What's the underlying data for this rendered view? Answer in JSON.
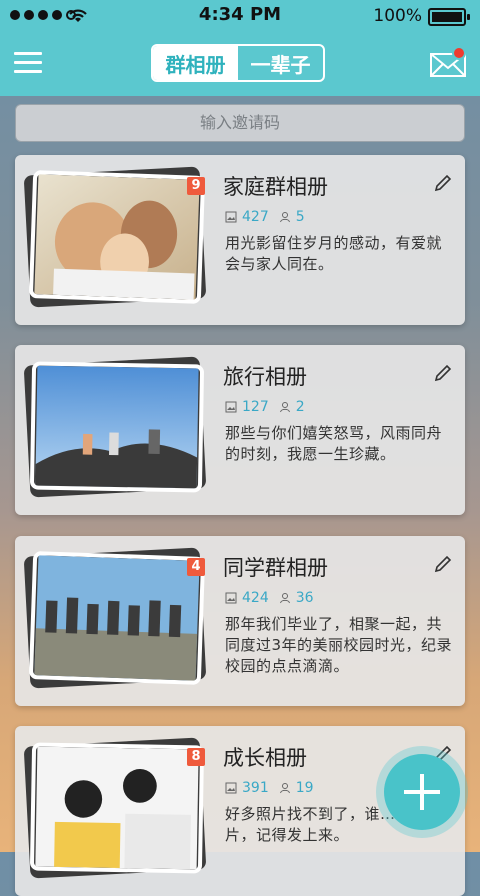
{
  "status_bar": {
    "time": "4:34 PM",
    "battery": "100%"
  },
  "nav": {
    "segments": [
      "群相册",
      "一辈子"
    ],
    "active_index": 0
  },
  "invite": {
    "placeholder": "输入邀请码"
  },
  "albums": [
    {
      "title": "家庭群相册",
      "badge": "9",
      "photos": "427",
      "members": "5",
      "desc": "用光影留住岁月的感动，有爱就会与家人同在。"
    },
    {
      "title": "旅行相册",
      "badge": "",
      "photos": "127",
      "members": "2",
      "desc": "那些与你们嬉笑怒骂，风雨同舟的时刻，我愿一生珍藏。"
    },
    {
      "title": "同学群相册",
      "badge": "4",
      "photos": "424",
      "members": "36",
      "desc": "那年我们毕业了，相聚一起，共同度过3年的美丽校园时光，纪录校园的点点滴滴。"
    },
    {
      "title": "成长相册",
      "badge": "8",
      "photos": "391",
      "members": "19",
      "desc": "好多照片找不到了，谁……亮照片，记得发上来。"
    }
  ],
  "colors": {
    "accent": "#5bc8cf",
    "badge": "#ef5a3c",
    "stat": "#3aa8c6"
  }
}
